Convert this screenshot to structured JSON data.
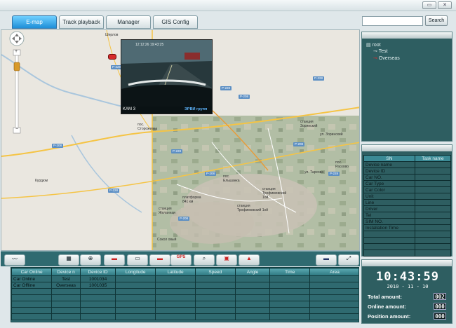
{
  "tabs": [
    {
      "label": "E-map"
    },
    {
      "label": "Track playback"
    },
    {
      "label": "Manager"
    },
    {
      "label": "GIS Config"
    }
  ],
  "search": {
    "placeholder": "",
    "button_label": "Search"
  },
  "map": {
    "labels": {
      "sherlov": "Шерлов",
      "pos_storozhevka": "пос.\nСторожевка",
      "kurdyum": "Курдюм",
      "pos_elshanka": "пос.\nЕльшанка",
      "platforma": "платформа\n841 км",
      "stantsiya_zhelannaya": "станция\nЖеланная",
      "sokolovyy": "Сокол овый",
      "st_trofimovsky": "станция\nТрофимовский\n1ой",
      "st_trofimovsky2": "станция\nТрофимовский 1ой",
      "st_zorinsky": "станция\nЗоринский",
      "ul_zorinsky": "ул. Зоринский",
      "pos_rasskazovo": "пос.\nРасково",
      "ul_tarkova": "ул. Тархова"
    },
    "roads": [
      "Р-228",
      "Р-208",
      "Р-228",
      "Р-208",
      "Р-228",
      "Р-208",
      "Р-228",
      "Р-208",
      "Р-228",
      "Р-208",
      "Р-228",
      "Р-208"
    ],
    "zoom_plus": "+",
    "zoom_minus": "−"
  },
  "video": {
    "channel": "KAM 3",
    "watermark": "ЭРВИ групп",
    "timestamp": "12:12:26 19:43:25"
  },
  "tree": {
    "root": "root",
    "children": [
      {
        "label": "Test"
      },
      {
        "label": "Overseas"
      }
    ]
  },
  "info": {
    "header_sn": "SN",
    "header_task": "Task name",
    "fields": [
      "Device name",
      "Device ID",
      "Car NO.",
      "Car Type",
      "Car Color",
      "Unit",
      "Line",
      "Driver",
      "Tel",
      "SIM NO.",
      "Installation Time",
      "",
      "",
      "",
      ""
    ]
  },
  "grid": {
    "columns": [
      "Car Online",
      "Device n",
      "Device ID",
      "Longitude",
      "Latitude",
      "Speed",
      "Angle",
      "Time",
      "Area"
    ],
    "rows": [
      [
        "Car Online",
        "Test",
        "1001034",
        "",
        "",
        "",
        "",
        "",
        ""
      ],
      [
        "Car Offline",
        "Overseas",
        "1001035",
        "",
        "",
        "",
        "",
        "",
        ""
      ]
    ],
    "empty_rows": 5
  },
  "clock": {
    "time": "10:43:59",
    "date": "2010 - 11 - 10",
    "total_label": "Total amount:",
    "total_value": "002",
    "online_label": "Online amount:",
    "online_value": "000",
    "position_label": "Position amount:",
    "position_value": "000"
  },
  "colors": {
    "accent": "#1e8fd8",
    "panel": "#2e5e61",
    "online": "#e02b2b"
  }
}
